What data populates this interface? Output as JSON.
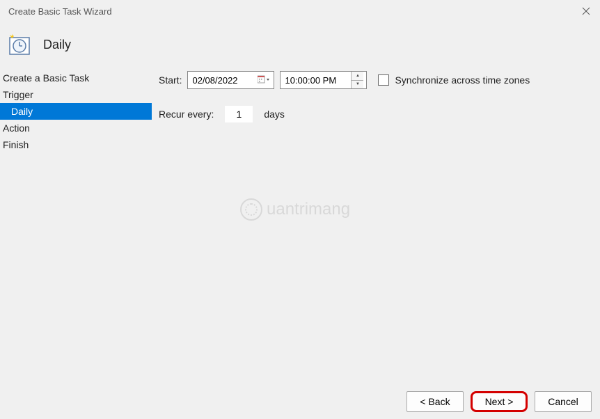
{
  "titlebar": {
    "title": "Create Basic Task Wizard"
  },
  "header": {
    "title": "Daily"
  },
  "sidebar": {
    "items": [
      {
        "label": "Create a Basic Task",
        "indented": false,
        "selected": false
      },
      {
        "label": "Trigger",
        "indented": false,
        "selected": false
      },
      {
        "label": "Daily",
        "indented": true,
        "selected": true
      },
      {
        "label": "Action",
        "indented": false,
        "selected": false
      },
      {
        "label": "Finish",
        "indented": false,
        "selected": false
      }
    ]
  },
  "form": {
    "start_label": "Start:",
    "date_value": "02/08/2022",
    "time_value": "10:00:00 PM",
    "sync_label": "Synchronize across time zones",
    "recur_label": "Recur every:",
    "recur_value": "1",
    "recur_unit": "days"
  },
  "footer": {
    "back_label": "< Back",
    "next_label": "Next >",
    "cancel_label": "Cancel"
  },
  "watermark": {
    "text": "uantrimang"
  }
}
